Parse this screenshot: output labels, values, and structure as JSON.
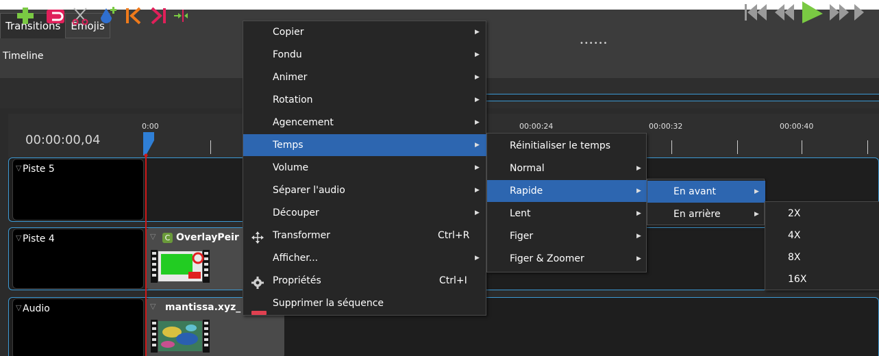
{
  "tabs": [
    {
      "label": "Transitions"
    },
    {
      "label": "Émojis"
    }
  ],
  "panel_title": "Timeline",
  "timecode": "00:00:00,04",
  "ruler_labels": [
    "0:00",
    "00:00:24",
    "00:00:32",
    "00:00:40"
  ],
  "tracks": [
    {
      "name": "Piste 5"
    },
    {
      "name": "Piste 4",
      "clip": {
        "badge": "C",
        "title": "OverlayPeir"
      }
    },
    {
      "name": "Audio",
      "clip": {
        "title": "mantissa.xyz_"
      }
    }
  ],
  "context_menu": {
    "items": [
      {
        "label": "Copier",
        "submenu": true
      },
      {
        "label": "Fondu",
        "submenu": true
      },
      {
        "label": "Animer",
        "submenu": true
      },
      {
        "label": "Rotation",
        "submenu": true
      },
      {
        "label": "Agencement",
        "submenu": true
      },
      {
        "label": "Temps",
        "submenu": true,
        "highlighted": true
      },
      {
        "label": "Volume",
        "submenu": true
      },
      {
        "label": "Séparer l'audio",
        "submenu": true
      },
      {
        "label": "Découper",
        "submenu": true
      },
      {
        "label": "Transformer",
        "shortcut": "Ctrl+R",
        "icon": "move-icon"
      },
      {
        "label": "Afficher...",
        "submenu": true
      },
      {
        "label": "Propriétés",
        "shortcut": "Ctrl+I",
        "icon": "gear-icon"
      },
      {
        "label": "Supprimer la séquence",
        "icon": "remove-icon"
      }
    ]
  },
  "temps_menu": {
    "items": [
      {
        "label": "Réinitialiser le temps"
      },
      {
        "label": "Normal",
        "submenu": true
      },
      {
        "label": "Rapide",
        "submenu": true,
        "highlighted": true
      },
      {
        "label": "Lent",
        "submenu": true
      },
      {
        "label": "Figer",
        "submenu": true
      },
      {
        "label": "Figer & Zoomer",
        "submenu": true
      }
    ]
  },
  "rapide_menu": {
    "items": [
      {
        "label": "En avant",
        "submenu": true,
        "highlighted": true
      },
      {
        "label": "En arrière",
        "submenu": true
      }
    ]
  },
  "speed_menu": {
    "items": [
      {
        "label": "2X"
      },
      {
        "label": "4X"
      },
      {
        "label": "8X"
      },
      {
        "label": "16X"
      }
    ]
  },
  "colors": {
    "highlight": "#2d66b0",
    "accent_border": "#3d9bd6",
    "playhead": "#d01818"
  }
}
